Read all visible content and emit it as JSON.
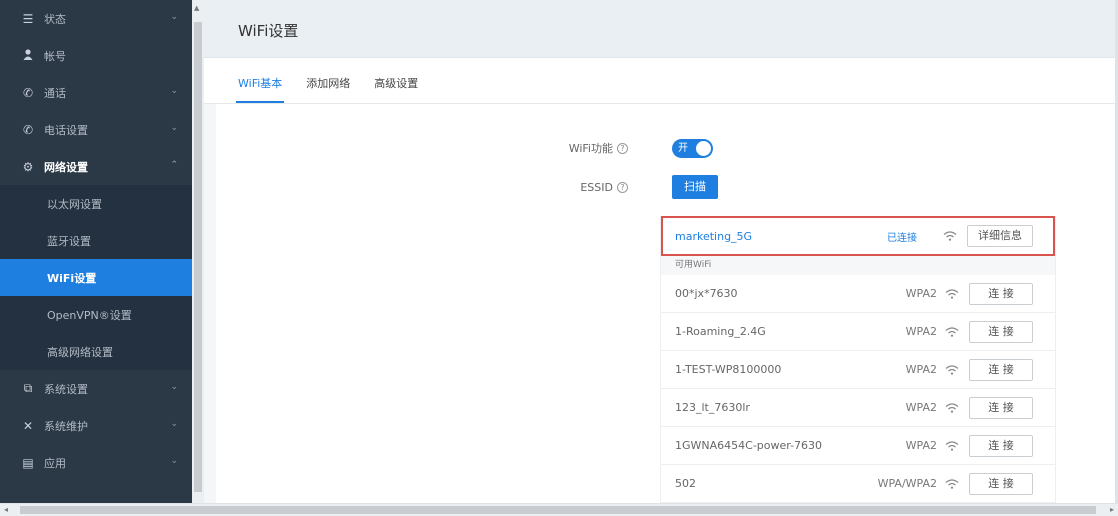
{
  "sidebar": {
    "items": [
      {
        "icon": "list-icon",
        "label": "状态",
        "chevron": "⌄"
      },
      {
        "icon": "user-icon",
        "label": "帐号",
        "chevron": ""
      },
      {
        "icon": "phone-call-icon",
        "label": "通话",
        "chevron": "⌄"
      },
      {
        "icon": "phone-icon",
        "label": "电话设置",
        "chevron": "⌄"
      },
      {
        "icon": "network-icon",
        "label": "网络设置",
        "chevron": "⌃"
      }
    ],
    "sub_items": [
      {
        "label": "以太网设置"
      },
      {
        "label": "蓝牙设置"
      },
      {
        "label": "WiFi设置"
      },
      {
        "label": "OpenVPN®设置"
      },
      {
        "label": "高级网络设置"
      }
    ],
    "items_after": [
      {
        "icon": "system-settings-icon",
        "label": "系统设置",
        "chevron": "⌄"
      },
      {
        "icon": "tools-icon",
        "label": "系统维护",
        "chevron": "⌄"
      },
      {
        "icon": "app-icon",
        "label": "应用",
        "chevron": "⌄"
      }
    ]
  },
  "page": {
    "title": "WiFi设置",
    "tabs": [
      "WiFi基本",
      "添加网络",
      "高级设置"
    ]
  },
  "form": {
    "wifi_function_label": "WiFi功能",
    "toggle_label": "开",
    "essid_label": "ESSID",
    "scan_label": "扫描",
    "help": "?"
  },
  "wifi": {
    "connected": {
      "ssid": "marketing_5G",
      "status": "已连接",
      "detail_label": "详细信息"
    },
    "available_title": "可用WiFi",
    "connect_label": "连 接",
    "networks": [
      {
        "ssid": "00*jx*7630",
        "security": "WPA2"
      },
      {
        "ssid": "1-Roaming_2.4G",
        "security": "WPA2"
      },
      {
        "ssid": "1-TEST-WP8100000",
        "security": "WPA2"
      },
      {
        "ssid": "123_lt_7630lr",
        "security": "WPA2"
      },
      {
        "ssid": "1GWNA6454C-power-7630",
        "security": "WPA2"
      },
      {
        "ssid": "502",
        "security": "WPA/WPA2"
      }
    ]
  },
  "colors": {
    "accent": "#1e7fe0",
    "sidebar_bg": "#2b3846",
    "highlight_border": "#d9534f"
  }
}
